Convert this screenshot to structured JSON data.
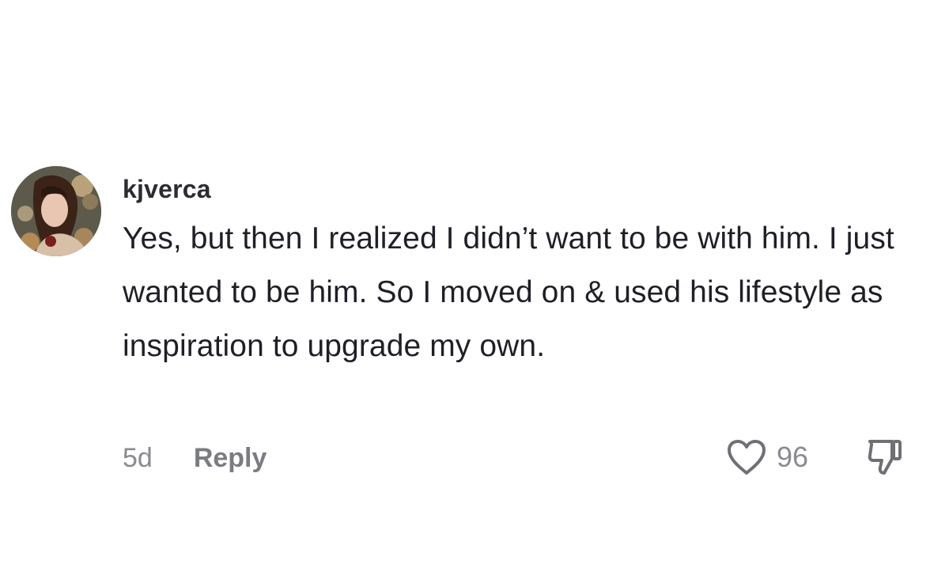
{
  "comment": {
    "username": "kjverca",
    "text": "Yes, but then I realized I didn’t want to be with him. I just wanted to be him. So I moved on & used his lifestyle as inspiration to upgrade my own.",
    "timestamp": "5d",
    "reply_label": "Reply",
    "like_count": "96",
    "icons": {
      "avatar": "profile-photo",
      "like": "heart-outline-icon",
      "dislike": "thumbs-down-icon"
    }
  }
}
